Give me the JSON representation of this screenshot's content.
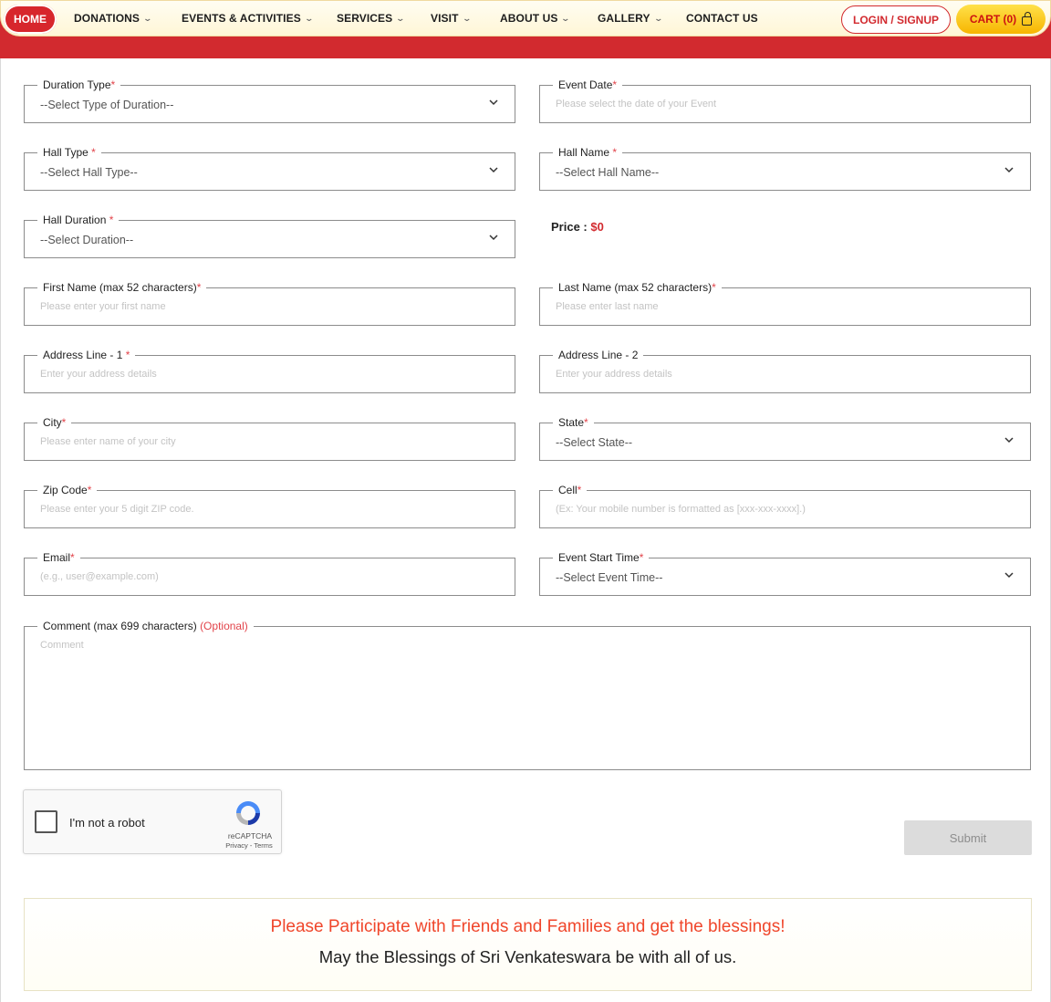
{
  "nav": {
    "home": "HOME",
    "items": [
      {
        "label": "DONATIONS",
        "dropdown": true
      },
      {
        "label": "EVENTS & ACTIVITIES",
        "dropdown": true
      },
      {
        "label": "SERVICES",
        "dropdown": true
      },
      {
        "label": "VISIT",
        "dropdown": true
      },
      {
        "label": "ABOUT US",
        "dropdown": true
      },
      {
        "label": "GALLERY",
        "dropdown": true
      },
      {
        "label": "CONTACT US",
        "dropdown": false
      }
    ],
    "login": "LOGIN / SIGNUP",
    "cart": "CART (0)"
  },
  "form": {
    "duration_type": {
      "label": "Duration Type",
      "value": "--Select Type of Duration--"
    },
    "event_date": {
      "label": "Event Date",
      "placeholder": "Please select the date of your Event"
    },
    "hall_type": {
      "label": "Hall Type ",
      "value": "--Select Hall Type--"
    },
    "hall_name": {
      "label": "Hall Name ",
      "value": "--Select Hall Name--"
    },
    "hall_duration": {
      "label": "Hall Duration ",
      "value": "--Select Duration--"
    },
    "price": {
      "label": "Price : ",
      "value": "$0"
    },
    "first_name": {
      "label": "First Name (max 52 characters)",
      "placeholder": "Please enter your first name"
    },
    "last_name": {
      "label": "Last Name (max 52 characters)",
      "placeholder": "Please enter last name"
    },
    "address1": {
      "label": "Address Line - 1 ",
      "placeholder": "Enter your address details"
    },
    "address2": {
      "label": "Address Line - 2",
      "placeholder": "Enter your address details"
    },
    "city": {
      "label": "City",
      "placeholder": "Please enter name of your city"
    },
    "state": {
      "label": "State",
      "value": "--Select State--"
    },
    "zip": {
      "label": "Zip Code",
      "placeholder": "Please enter your 5 digit ZIP code."
    },
    "cell": {
      "label": "Cell",
      "placeholder": "(Ex: Your mobile number is formatted as [xxx-xxx-xxxx].)"
    },
    "email": {
      "label": "Email",
      "placeholder": "(e.g., user@example.com)"
    },
    "event_start_time": {
      "label": "Event Start Time",
      "value": "--Select Event Time--"
    },
    "comment": {
      "label": "Comment (max 699 characters) ",
      "optional": "(Optional)",
      "placeholder": "Comment"
    },
    "required_mark": "*"
  },
  "captcha": {
    "label": "I'm not a robot",
    "brand": "reCAPTCHA",
    "terms": "Privacy - Terms"
  },
  "submit": "Submit",
  "blessing": {
    "line1": "Please Participate with Friends and Families and get the blessings!",
    "line2": "May the Blessings of Sri Venkateswara be with all of us."
  },
  "colors": {
    "brand_red": "#d22a2f",
    "cart_yellow": "#f7b500",
    "accent_orange": "#f0462b"
  }
}
